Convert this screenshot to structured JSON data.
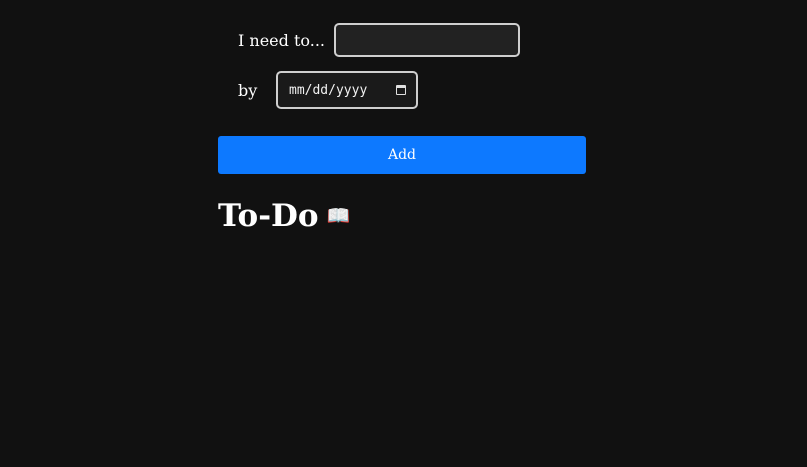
{
  "form": {
    "task_label": "I need to...",
    "task_value": "",
    "date_label": "by",
    "date_placeholder": "mm/dd/yyyy",
    "add_label": "Add"
  },
  "list": {
    "title": "To-Do",
    "title_icon": "📖",
    "title_icon_name": "open-book-icon"
  },
  "colors": {
    "background": "#111111",
    "accent": "#0d79ff",
    "text": "#ffffff"
  }
}
